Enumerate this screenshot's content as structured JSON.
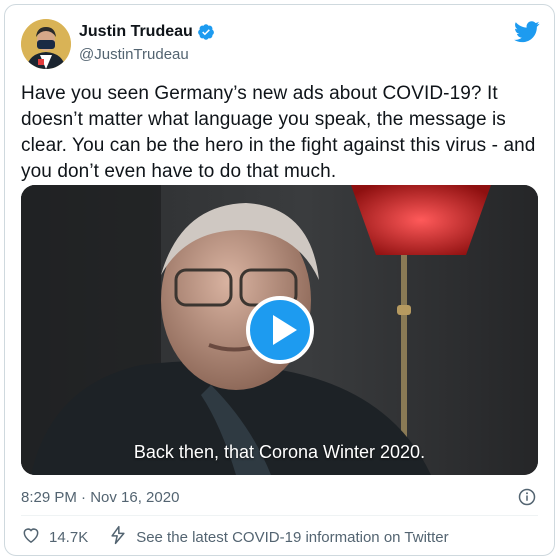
{
  "author": {
    "name": "Justin Trudeau",
    "handle": "@JustinTrudeau",
    "verified_icon": "verified-badge-icon",
    "avatar_icon": "avatar"
  },
  "brand": {
    "icon": "twitter-bird-icon",
    "color": "#1d9bf0"
  },
  "tweet": {
    "text": "Have you seen Germany’s new ads about COVID-19? It doesn’t matter what language you speak, the message is clear. You can be the hero in the fight against this virus - and you don’t even have to do that much."
  },
  "video": {
    "subtitle": "Back then, that Corona Winter 2020.",
    "play_icon": "play-icon"
  },
  "meta": {
    "timestamp": "8:29 PM · Nov 16, 2020",
    "info_icon": "info-icon"
  },
  "actions": {
    "like_count": "14.7K",
    "like_icon": "heart-icon",
    "covid_label": "See the latest COVID-19 information on Twitter",
    "covid_icon": "lightning-icon"
  },
  "colors": {
    "text": "#0f1419",
    "secondary": "#536471",
    "accent": "#1d9bf0",
    "border": "#cfd9de"
  }
}
